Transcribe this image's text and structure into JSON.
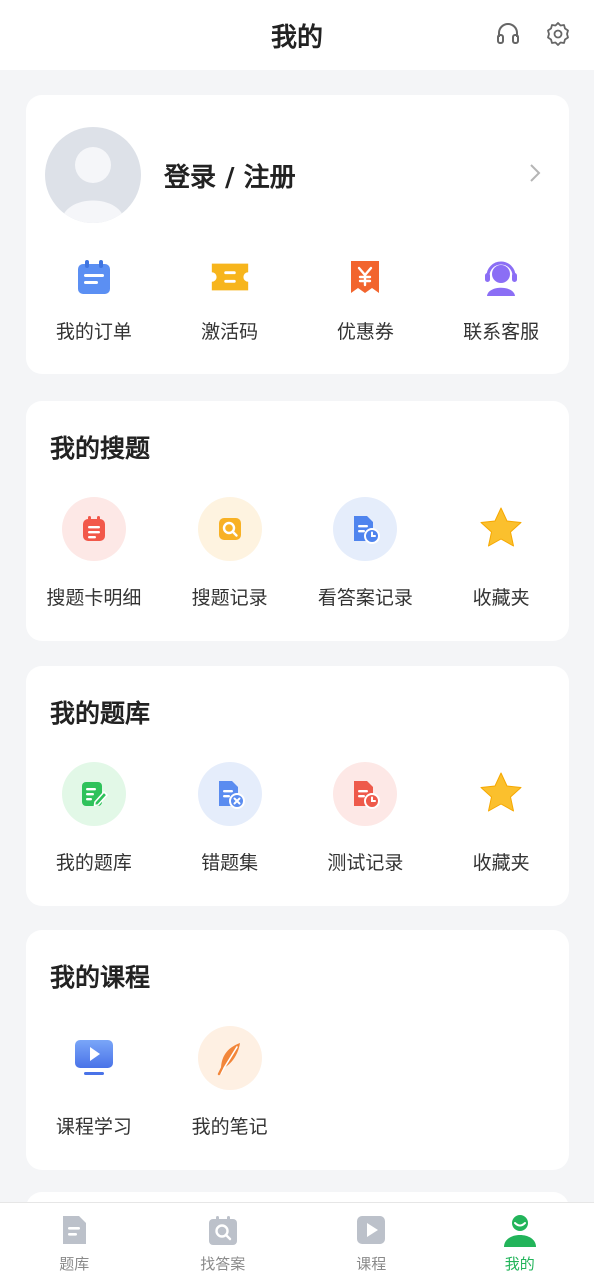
{
  "header": {
    "title": "我的"
  },
  "user": {
    "login_label": "登录 / 注册"
  },
  "quick_actions": [
    {
      "label": "我的订单",
      "icon": "order-calendar-icon"
    },
    {
      "label": "激活码",
      "icon": "ticket-icon"
    },
    {
      "label": "优惠券",
      "icon": "coupon-yen-icon"
    },
    {
      "label": "联系客服",
      "icon": "customer-service-icon"
    }
  ],
  "search_section": {
    "title": "我的搜题",
    "items": [
      {
        "label": "搜题卡明细",
        "icon": "search-card-icon"
      },
      {
        "label": "搜题记录",
        "icon": "search-record-icon"
      },
      {
        "label": "看答案记录",
        "icon": "answer-record-icon"
      },
      {
        "label": "收藏夹",
        "icon": "star-icon"
      }
    ]
  },
  "bank_section": {
    "title": "我的题库",
    "items": [
      {
        "label": "我的题库",
        "icon": "edit-doc-icon"
      },
      {
        "label": "错题集",
        "icon": "wrong-doc-icon"
      },
      {
        "label": "测试记录",
        "icon": "test-record-icon"
      },
      {
        "label": "收藏夹",
        "icon": "star-icon"
      }
    ]
  },
  "course_section": {
    "title": "我的课程",
    "items": [
      {
        "label": "课程学习",
        "icon": "video-screen-icon"
      },
      {
        "label": "我的笔记",
        "icon": "feather-icon"
      }
    ]
  },
  "tabbar": {
    "tabs": [
      {
        "label": "题库",
        "icon": "question-bank-icon",
        "active": false
      },
      {
        "label": "找答案",
        "icon": "find-answer-icon",
        "active": false
      },
      {
        "label": "课程",
        "icon": "course-play-icon",
        "active": false
      },
      {
        "label": "我的",
        "icon": "profile-icon",
        "active": true
      }
    ]
  },
  "colors": {
    "accent": "#22b45a",
    "background": "#f4f5f7"
  }
}
